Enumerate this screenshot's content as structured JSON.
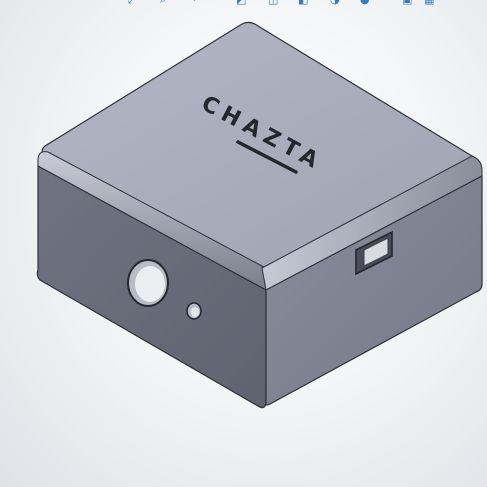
{
  "app": {
    "view": "3D part model viewport"
  },
  "model": {
    "engraved_text": "CHAZTA",
    "colors": {
      "top_face": "#a9aebd",
      "front_face": "#6a6e7b",
      "right_face": "#7d8190",
      "edge": "#2f3138",
      "fillet_highlight": "#c4c8d3"
    }
  },
  "toolbar": {
    "icons": [
      {
        "name": "zoom-to-fit-icon",
        "glyph": "⤢"
      },
      {
        "name": "zoom-area-icon",
        "glyph": "⌕"
      },
      {
        "name": "previous-view-icon",
        "glyph": "↶"
      },
      {
        "name": "section-view-icon",
        "glyph": "◩"
      },
      {
        "name": "view-orientation-icon",
        "glyph": "◫"
      },
      {
        "name": "display-style-icon",
        "glyph": "◧"
      },
      {
        "name": "hide-show-icon",
        "glyph": "◑"
      },
      {
        "name": "appearance-icon",
        "glyph": "●"
      },
      {
        "name": "scene-icon",
        "glyph": "▣"
      },
      {
        "name": "view-settings-icon",
        "glyph": "▦"
      }
    ]
  }
}
